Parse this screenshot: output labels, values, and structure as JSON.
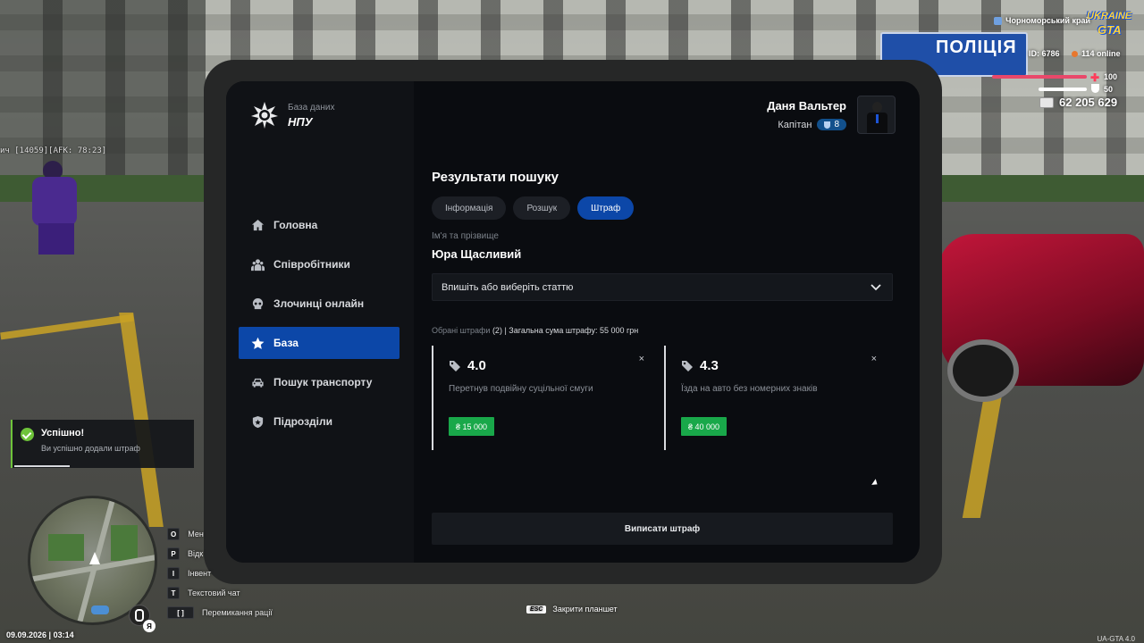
{
  "hud": {
    "region": "Чорноморський край",
    "logo_line1": "UKRAINE",
    "logo_line2": "GTA",
    "player_id": "ID: 6786",
    "online": "114 online",
    "health": "100",
    "armor": "50",
    "money": "62 205 629",
    "afk_tag": "ич [14059][AFK: 78:23]",
    "police_sign": "ПОЛІЦІЯ"
  },
  "tablet": {
    "brand_subtitle": "База даних",
    "brand_title": "НПУ",
    "user_name": "Даня Вальтер",
    "user_rank": "Капітан",
    "user_level": "8",
    "nav": [
      {
        "label": "Головна",
        "icon": "home-icon"
      },
      {
        "label": "Співробітники",
        "icon": "staff-icon"
      },
      {
        "label": "Злочинці онлайн",
        "icon": "criminal-icon"
      },
      {
        "label": "База",
        "icon": "star-icon",
        "active": true
      },
      {
        "label": "Пошук транспорту",
        "icon": "car-icon"
      },
      {
        "label": "Підрозділи",
        "icon": "shield-icon"
      }
    ],
    "section_title": "Результати пошуку",
    "tabs": [
      {
        "label": "Інформація"
      },
      {
        "label": "Розшук"
      },
      {
        "label": "Штраф",
        "active": true
      }
    ],
    "name_label": "Ім'я та прізвище",
    "name_value": "Юра Щасливий",
    "article_placeholder": "Впишіть або виберіть статтю",
    "summary_muted": "Обрані штрафи",
    "summary_count": "(2)",
    "summary_rest": "| Загальна сума штрафу: 55 000 грн",
    "fines": [
      {
        "code": "4.0",
        "description": "Перетнув подвійну суцільної смуги",
        "amount": "₴ 15 000"
      },
      {
        "code": "4.3",
        "description": "Їзда на авто без номерних знаків",
        "amount": "₴ 40 000"
      }
    ],
    "close_symbol": "×",
    "submit_label": "Виписати штраф"
  },
  "notification": {
    "title": "Успішно!",
    "text": "Ви успішно додали штраф",
    "accent": "#6ec33a"
  },
  "hints": [
    {
      "key": "O",
      "label": "Мен"
    },
    {
      "key": "P",
      "label": "Відк"
    },
    {
      "key": "I",
      "label": "Інвент"
    },
    {
      "key": "T",
      "label": "Текстовий чат"
    },
    {
      "key": "[ ]",
      "label": "Перемикання рації"
    }
  ],
  "minimap": {
    "lang": "Я"
  },
  "datetime": "09.09.2026 | 03:14",
  "esc_key": "ESC",
  "esc_label": "Закрити планшет",
  "version": "UA-GTA 4.0",
  "colors": {
    "accent_blue": "#0c47a8",
    "success_green": "#19a84a",
    "panel": "#0a0c10"
  }
}
